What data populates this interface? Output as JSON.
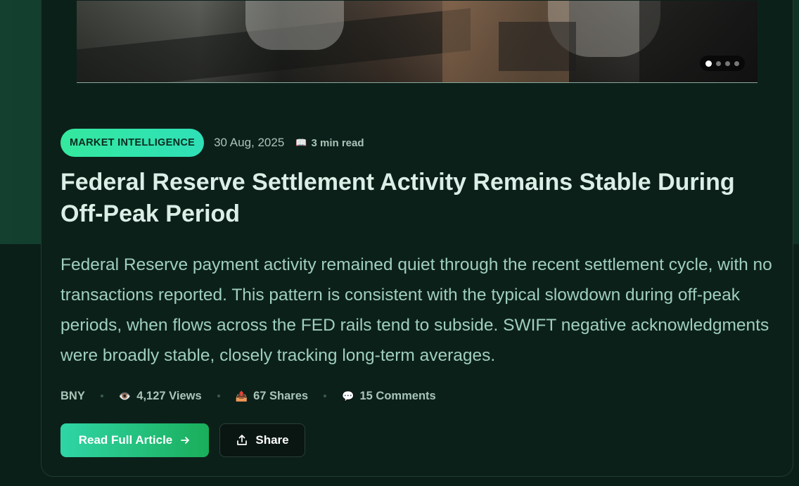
{
  "article": {
    "category": "MARKET INTELLIGENCE",
    "date": "30 Aug, 2025",
    "read_time": "3 min read",
    "title": "Federal Reserve Settlement Activity Remains Stable During Off-Peak Period",
    "excerpt": "Federal Reserve payment activity remained quiet through the recent settlement cycle, with no transactions reported. This pattern is consistent with the typical slowdown during off-peak periods, when flows across the FED rails tend to subside. SWIFT negative acknowledgments were broadly stable, closely tracking long-term averages.",
    "source": "BNY",
    "views": "4,127 Views",
    "shares": "67 Shares",
    "comments": "15 Comments"
  },
  "carousel": {
    "slide_count": 4,
    "active_index": 0
  },
  "buttons": {
    "read_full": "Read Full Article",
    "share": "Share"
  },
  "icons": {
    "read_time": "book-icon",
    "views": "eye-icon",
    "shares": "outbox-icon",
    "comments": "speech-bubble-icon",
    "read_full": "arrow-right-icon",
    "share": "share-upload-icon"
  },
  "colors": {
    "accent_start": "#34e89e",
    "accent_end": "#1aae5a",
    "title": "#dcefe6",
    "excerpt": "#9fcfbd",
    "background": "#0c201a"
  }
}
